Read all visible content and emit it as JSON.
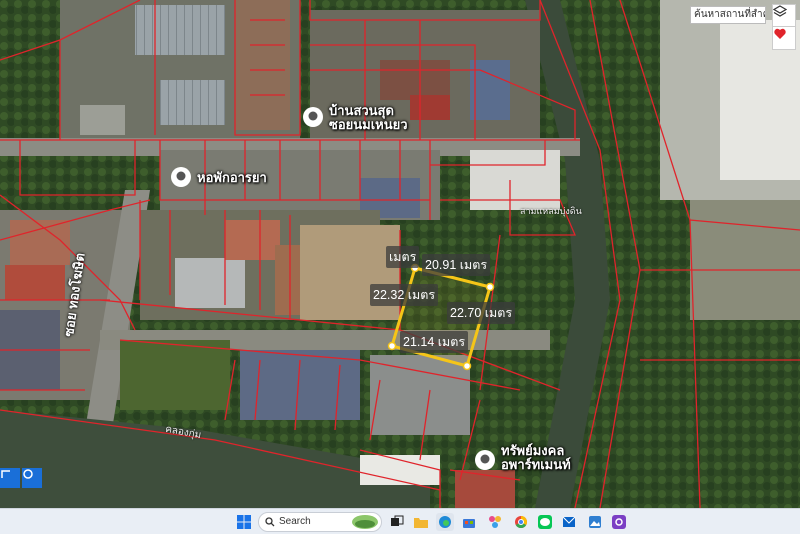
{
  "map": {
    "search_placeholder": "ค้นหาสถานที่สำคัญ",
    "places": [
      {
        "id": "ban-suan",
        "line1": "บ้านสวนสุด",
        "line2": "ซอยนมเหนยว"
      },
      {
        "id": "horpak",
        "line1": "หอพักอารยา",
        "line2": ""
      },
      {
        "id": "apartment",
        "line1": "ทรัพย์มงคล",
        "line2": "อพาร์ทเมนท์"
      }
    ],
    "road_label": "ซอย ทองโฆษิต",
    "canal_label": "คลองกุ่ม",
    "small_label": "สามแหลมบุ่งดิน",
    "measurements": {
      "top": "20.91 เมตร",
      "left": "22.32 เมตร",
      "right": "22.70 เมตร",
      "bottom": "21.14 เมตร",
      "partial": "เมตร"
    },
    "accent": "#f5c518",
    "parcel_line_color": "#e0242b"
  },
  "taskbar": {
    "search_label": "Search"
  }
}
